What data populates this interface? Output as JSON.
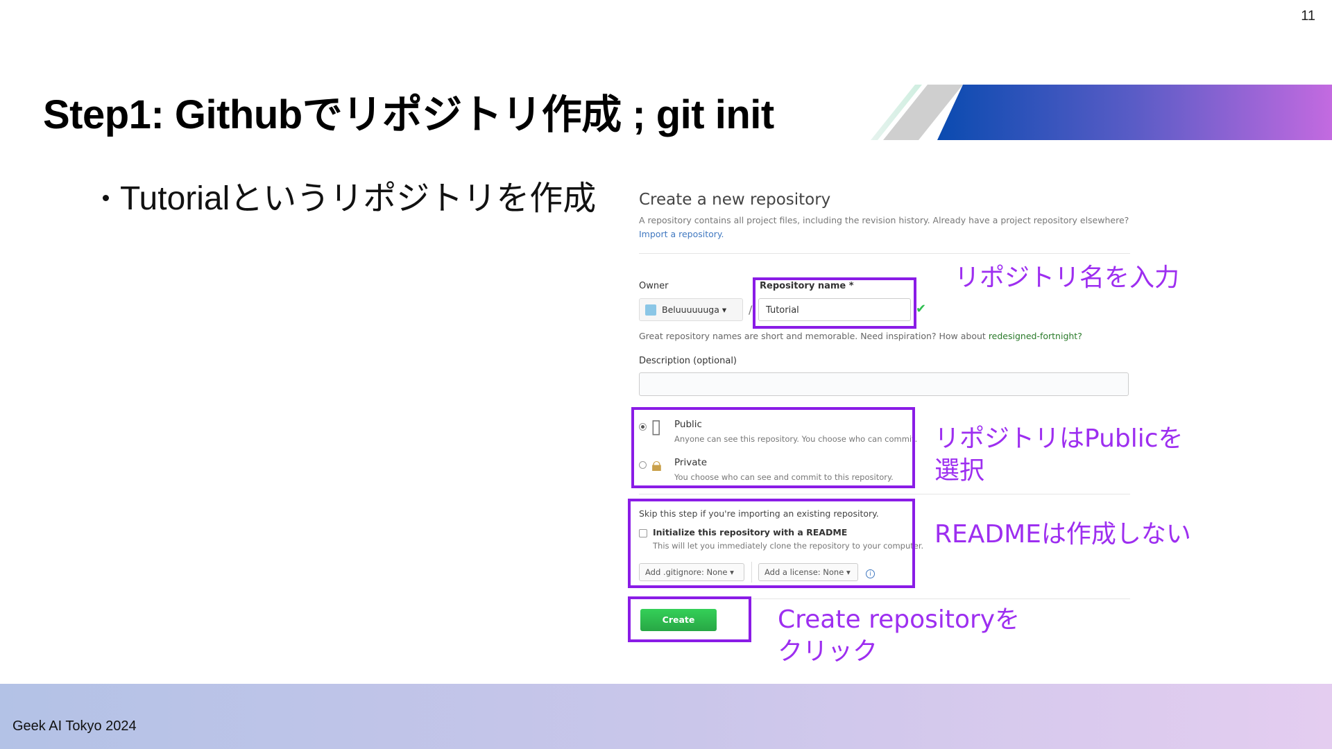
{
  "slide": {
    "number": "11",
    "title": "Step1: Githubでリポジトリ作成 ; git init",
    "bullet": "Tutorialというリポジトリを作成",
    "footer": "Geek AI Tokyo 2024"
  },
  "github_form": {
    "heading": "Create a new repository",
    "subtitle": "A repository contains all project files, including the revision history. Already have a project repository elsewhere?",
    "import_link": "Import a repository.",
    "owner_label": "Owner",
    "owner_value": "Beluuuuuuga ▾",
    "repo_label": "Repository name *",
    "repo_value": "Tutorial",
    "name_hint": "Great repository names are short and memorable. Need inspiration? How about",
    "name_suggestion": "redesigned-fortnight?",
    "description_label": "Description (optional)",
    "public_title": "Public",
    "public_desc": "Anyone can see this repository. You choose who can commit.",
    "private_title": "Private",
    "private_desc": "You choose who can see and commit to this repository.",
    "skip_text": "Skip this step if you're importing an existing repository.",
    "readme_title": "Initialize this repository with a README",
    "readme_desc": "This will let you immediately clone the repository to your computer.",
    "gitignore_select": "Add .gitignore: None ▾",
    "license_select": "Add a license: None ▾",
    "create_button": "Create repository"
  },
  "annotations": {
    "repo_name": "リポジトリ名を入力",
    "public_line1": "リポジトリはPublicを",
    "public_line2": "選択",
    "readme": "READMEは作成しない",
    "create_line1": "Create repositoryを",
    "create_line2": "クリック"
  },
  "colors": {
    "highlight": "#8a1ce6",
    "annotation_text": "#9d2ef0",
    "create_button": "#2cbe4e"
  }
}
